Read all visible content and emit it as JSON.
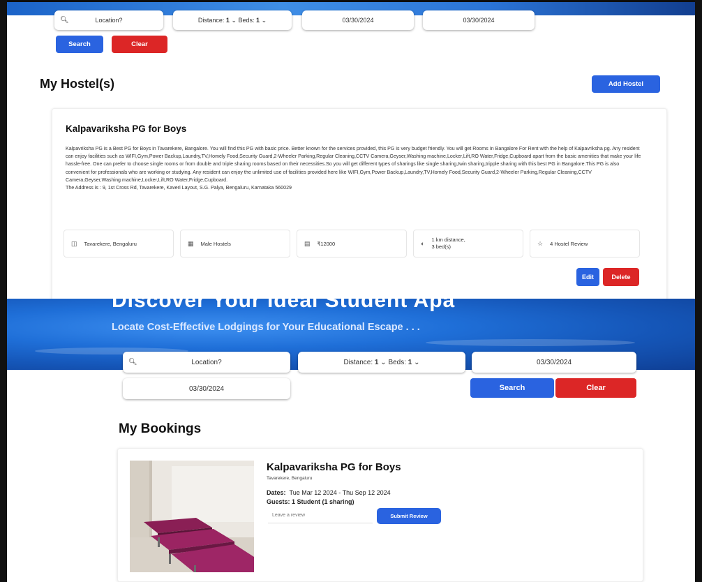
{
  "top": {
    "search": {
      "location_placeholder": "Location?",
      "distance_label": "Distance:",
      "distance_value": "1",
      "beds_label": "Beds:",
      "beds_value": "1",
      "checkin_date": "03/30/2024",
      "checkout_date": "03/30/2024",
      "search_label": "Search",
      "clear_label": "Clear"
    },
    "section_title": "My Hostel(s)",
    "add_hostel_label": "Add Hostel",
    "hostel": {
      "name": "Kalpavariksha PG for Boys",
      "description": "Kalpavriksha PG is a Best PG for Boys in Tavarekere, Bangalore. You will find this PG with basic price. Better known for the services provided, this PG is very budget friendly. You will get Rooms In Bangalore For Rent with the help of Kalpavriksha pg. Any resident can enjoy facilities such as WIFI,Gym,Power Backup,Laundry,TV,Homely Food,Security Guard,2-Wheeler Parking,Regular Cleaning,CCTV Camera,Geyser,Washing machine,Locker,Lift,RO Water,Fridge,Cupboard apart from the basic amenities that make your life hassle-free. One can prefer to choose single rooms or from double and triple sharing rooms based on their necessities.So you will get different types of sharings like single sharing,twin sharing,tripple sharing with this best PG in Bangalore.This PG is also convenient for professionals who are working or studying. Any resident can enjoy the unlimited use of facilities provided here like WIFI,Gym,Power Backup,Laundry,TV,Homely Food,Security Guard,2-Wheeler Parking,Regular Cleaning,CCTV Camera,Geyser,Washing machine,Locker,Lift,RO Water,Fridge,Cupboard.",
      "address": "The Address is : 9, 1st Cross Rd, Tavarekere, Kaveri Layout, S.G. Palya, Bengaluru, Karnataka 560029",
      "location": "Tavarekere, Bengaluru",
      "type": "Male Hostels",
      "price": "₹12000",
      "distance": "1 km distance,",
      "beds": "3 bed(s)",
      "reviews": "4 Hostel Review",
      "edit_label": "Edit",
      "delete_label": "Delete"
    }
  },
  "bottom": {
    "hero_title": "Discover Your Ideal Student Apa",
    "hero_subtitle": "Locate Cost-Effective Lodgings for Your Educational Escape . . .",
    "search": {
      "location_placeholder": "Location?",
      "distance_label": "Distance:",
      "distance_value": "1",
      "beds_label": "Beds:",
      "beds_value": "1",
      "checkin_date": "03/30/2024",
      "checkout_date": "03/30/2024",
      "search_label": "Search",
      "clear_label": "Clear"
    },
    "section_title": "My Bookings",
    "booking": {
      "name": "Kalpavariksha PG for Boys",
      "location": "Tavarekere, Bengaluru",
      "dates_label": "Dates:",
      "dates_value": "Tue Mar 12 2024 - Thu Sep 12 2024",
      "guests": "Guests: 1 Student (1 sharing)",
      "review_placeholder": "Leave a review",
      "submit_label": "Submit Review"
    }
  },
  "colors": {
    "primary_blue": "#2a63e0",
    "danger_red": "#dc2626",
    "hero_blue": "#1f6fd8"
  },
  "icons": [
    "search-icon",
    "map-icon",
    "building-icon",
    "money-icon",
    "distance-icon",
    "star-icon"
  ]
}
